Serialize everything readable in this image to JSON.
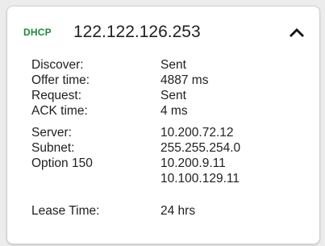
{
  "header": {
    "tag": "DHCP",
    "ip": "122.122.126.253",
    "toggle_icon": "chevron-up-icon"
  },
  "details": {
    "discover": {
      "label": "Discover:",
      "value": "Sent"
    },
    "offer_time": {
      "label": "Offer time:",
      "value": "4887 ms"
    },
    "request": {
      "label": "Request:",
      "value": "Sent"
    },
    "ack_time": {
      "label": "ACK time:",
      "value": "4 ms"
    },
    "server": {
      "label": "Server:",
      "value": "10.200.72.12"
    },
    "subnet": {
      "label": "Subnet:",
      "value": "255.255.254.0"
    },
    "option150": {
      "label": "Option 150",
      "values": [
        "10.200.9.11",
        "10.100.129.11"
      ]
    },
    "lease_time": {
      "label": "Lease Time:",
      "value": "24 hrs"
    }
  },
  "colors": {
    "tag": "#1f8a3a",
    "text": "#1f1f1f",
    "card_bg": "#ffffff",
    "page_bg": "#ececec"
  }
}
